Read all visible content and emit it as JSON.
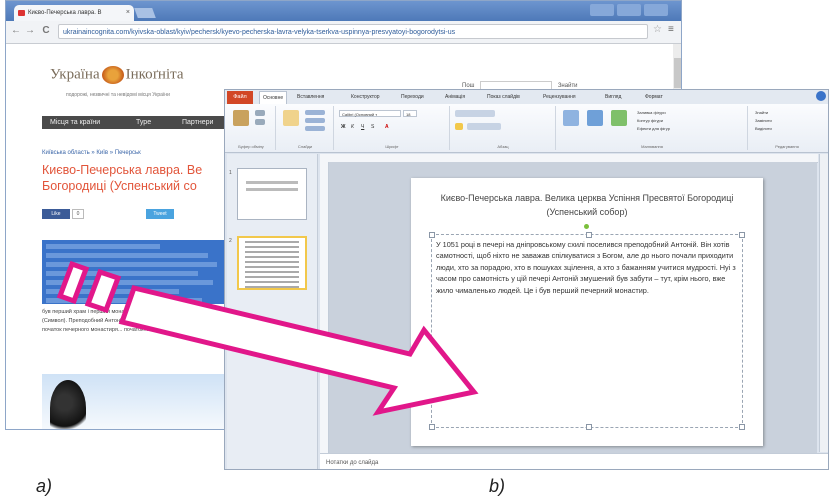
{
  "browser": {
    "tab_title": "Києво-Печерська лавра. В",
    "tab_close": "×",
    "nav": {
      "back": "←",
      "forward": "→",
      "reload": "C"
    },
    "url": "ukrainaincognita.com/kyivska-oblast/kyiv/pechersk/kyevo-pecherska-lavra-velyka-tserkva-uspinnya-presvyatoyi-bogorodytsi-us",
    "star": "☆",
    "menu": "≡",
    "site": {
      "logo_left": "Україна",
      "logo_right": "Інкоґніта",
      "tagline": "подорожі, незвичні та невідомі місця України",
      "menu_items": [
        "Місця та країни",
        "Туре",
        "Партнери"
      ],
      "search_label": "Пош",
      "search_button": "Знайти",
      "breadcrumb": "Київська область » Київ » Печерськ",
      "title": "Києво-Печерська лавра. Ве Богородиці (Успенський со",
      "like_label": "Like",
      "like_count": "0",
      "tweet_label": "Tweet",
      "body_text": "був перший храм і перший монастир Русі. Тут жили і працювали ченці (Символ). Преподобний Антоній виявився споруди і розпису — це був початок печерного монастиря... початок..."
    }
  },
  "ppt": {
    "file_tab": "Файл",
    "ribbon_tabs": [
      "Основне",
      "Вставлення",
      "Конструктор",
      "Переходи",
      "Анімація",
      "Показ слайдів",
      "Рецензування",
      "Вигляд",
      "Формат"
    ],
    "active_tab": "Основне",
    "groups": {
      "clipboard": "Буфер обміну",
      "slides": "Слайди",
      "font": "Шрифт",
      "paragraph": "Абзац",
      "drawing": "Малювання",
      "editing": "Редагування"
    },
    "font_name": "Calibri (Основний т",
    "font_size": "18",
    "ribbon_right": [
      "Заливка фігури",
      "Контур фігури",
      "Ефекти для фігур",
      "Знайти",
      "Замінити",
      "Виділити"
    ],
    "slide_numbers": [
      "1",
      "2"
    ],
    "slide": {
      "title": "Києво-Печерська лавра. Велика церква Успіння Пресвятої Богородиці (Успенський собор)",
      "body": "У 1051 році в печері на дніпровському схилі поселився преподобний Антоній. Він хотів самотності, щоб ніхто не заважав спілкуватися з Богом, але до нього почали приходити люди, хто за порадою, хто в пошуках зцілення, а хто з бажанням учитися мудрості. Нуі з часом про самотність у цій печері Антоній змушений був забути – тут, крім нього, вже жило чималенько людей. Це і був перший печерний монастир."
    },
    "notes_placeholder": "Нотатки до слайда"
  },
  "captions": {
    "a": "a)",
    "b": "b)"
  },
  "colors": {
    "arrow_pink": "#e1178a",
    "selection_blue": "#3a73c9",
    "title_orange": "#e2553a",
    "file_tab_red": "#d24726"
  }
}
